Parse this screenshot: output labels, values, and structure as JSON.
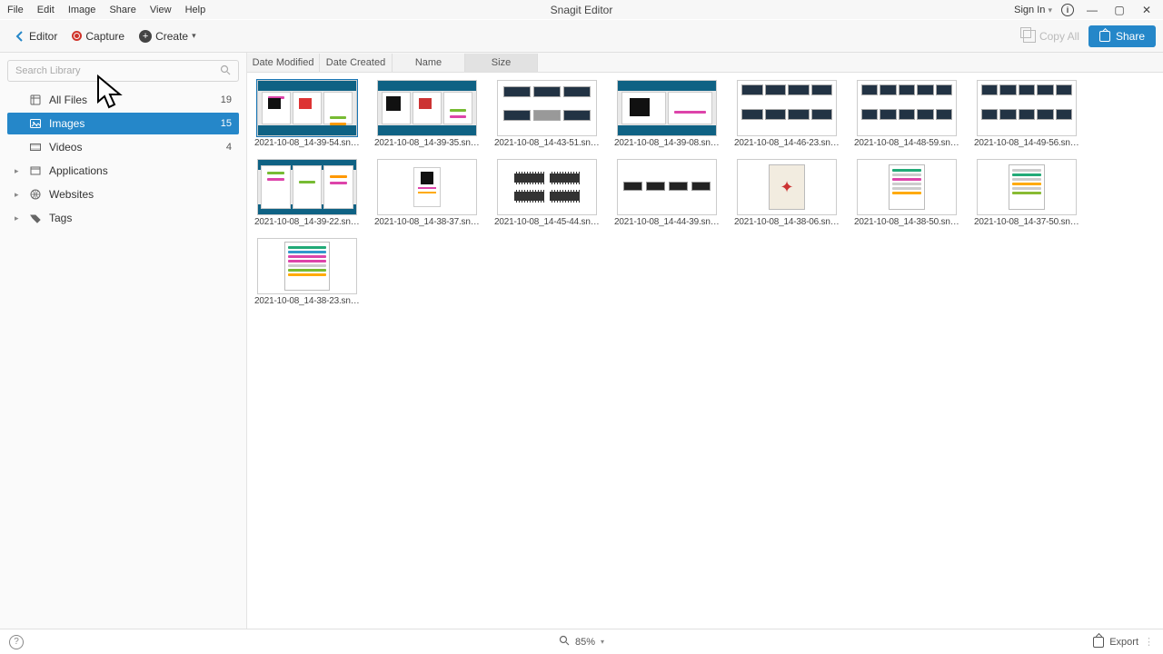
{
  "app": {
    "title": "Snagit Editor"
  },
  "menus": {
    "file": "File",
    "edit": "Edit",
    "image": "Image",
    "share": "Share",
    "view": "View",
    "help": "Help"
  },
  "window": {
    "signin": "Sign In"
  },
  "toolbar": {
    "editor": "Editor",
    "capture": "Capture",
    "create": "Create",
    "copy_all": "Copy All",
    "share": "Share"
  },
  "search": {
    "placeholder": "Search Library"
  },
  "sidebar": {
    "items": [
      {
        "label": "All Files",
        "count": "19"
      },
      {
        "label": "Images",
        "count": "15"
      },
      {
        "label": "Videos",
        "count": "4"
      },
      {
        "label": "Applications"
      },
      {
        "label": "Websites"
      },
      {
        "label": "Tags"
      }
    ]
  },
  "sort_tabs": {
    "t0": "Date Modified",
    "t1": "Date Created",
    "t2": "Name",
    "t3": "Size"
  },
  "files": {
    "f0": "2021-10-08_14-39-54.snagx",
    "f1": "2021-10-08_14-39-35.snagx",
    "f2": "2021-10-08_14-43-51.snagx",
    "f3": "2021-10-08_14-39-08.snagx",
    "f4": "2021-10-08_14-46-23.snagx",
    "f5": "2021-10-08_14-48-59.snagx",
    "f6": "2021-10-08_14-49-56.snagx",
    "f7": "2021-10-08_14-39-22.snagx",
    "f8": "2021-10-08_14-38-37.snagx",
    "f9": "2021-10-08_14-45-44.snagx",
    "f10": "2021-10-08_14-44-39.snagx",
    "f11": "2021-10-08_14-38-06.snagx",
    "f12": "2021-10-08_14-38-50.snagx",
    "f13": "2021-10-08_14-37-50.snagx",
    "f14": "2021-10-08_14-38-23.snagx"
  },
  "status": {
    "zoom": "85%",
    "export": "Export"
  }
}
